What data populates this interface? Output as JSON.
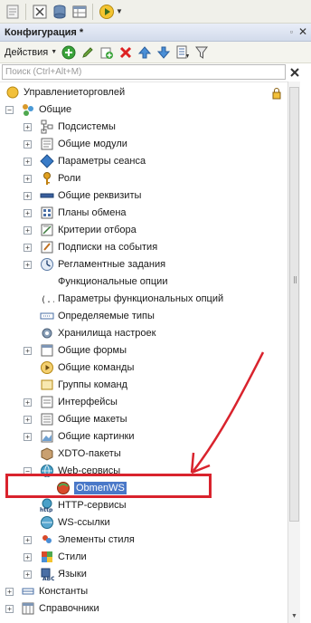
{
  "window": {
    "title": "Конфигурация *"
  },
  "toolbar": {
    "actions_label": "Действия"
  },
  "search": {
    "placeholder": "Поиск (Ctrl+Alt+M)",
    "value": ""
  },
  "tree": {
    "items": [
      {
        "label": "Управлениеторговлей",
        "icon": "config-root-icon",
        "expander": "none",
        "level": 0
      },
      {
        "label": "Общие",
        "icon": "common-folder-icon",
        "expander": "minus",
        "level": 1
      },
      {
        "label": "Подсистемы",
        "icon": "subsystems-icon",
        "expander": "plus",
        "level": 2
      },
      {
        "label": "Общие модули",
        "icon": "common-modules-icon",
        "expander": "plus",
        "level": 2
      },
      {
        "label": "Параметры сеанса",
        "icon": "session-params-icon",
        "expander": "plus",
        "level": 2
      },
      {
        "label": "Роли",
        "icon": "roles-key-icon",
        "expander": "plus",
        "level": 2
      },
      {
        "label": "Общие реквизиты",
        "icon": "common-attributes-icon",
        "expander": "plus",
        "level": 2
      },
      {
        "label": "Планы обмена",
        "icon": "exchange-plans-icon",
        "expander": "plus",
        "level": 2
      },
      {
        "label": "Критерии отбора",
        "icon": "filter-criteria-icon",
        "expander": "plus",
        "level": 2
      },
      {
        "label": "Подписки на события",
        "icon": "event-subscriptions-icon",
        "expander": "plus",
        "level": 2
      },
      {
        "label": "Регламентные задания",
        "icon": "scheduled-jobs-icon",
        "expander": "plus",
        "level": 2
      },
      {
        "label": "Функциональные опции",
        "icon": "functional-options-icon",
        "expander": "none",
        "level": 2
      },
      {
        "label": "Параметры функциональных опций",
        "icon": "functional-option-params-icon",
        "expander": "none",
        "level": 2
      },
      {
        "label": "Определяемые типы",
        "icon": "defined-types-icon",
        "expander": "none",
        "level": 2
      },
      {
        "label": "Хранилища настроек",
        "icon": "settings-storages-icon",
        "expander": "none",
        "level": 2
      },
      {
        "label": "Общие формы",
        "icon": "common-forms-icon",
        "expander": "plus",
        "level": 2
      },
      {
        "label": "Общие команды",
        "icon": "common-commands-icon",
        "expander": "none",
        "level": 2
      },
      {
        "label": "Группы команд",
        "icon": "command-groups-icon",
        "expander": "none",
        "level": 2
      },
      {
        "label": "Интерфейсы",
        "icon": "interfaces-icon",
        "expander": "plus",
        "level": 2
      },
      {
        "label": "Общие макеты",
        "icon": "common-templates-icon",
        "expander": "plus",
        "level": 2
      },
      {
        "label": "Общие картинки",
        "icon": "common-pictures-icon",
        "expander": "plus",
        "level": 2
      },
      {
        "label": "XDTO-пакеты",
        "icon": "xdto-packages-icon",
        "expander": "none",
        "level": 2
      },
      {
        "label": "Web-сервисы",
        "icon": "web-services-globe-icon",
        "expander": "minus",
        "level": 2
      },
      {
        "label": "ObmenWS",
        "icon": "web-service-item-icon",
        "expander": "none",
        "level": 3,
        "selected": true
      },
      {
        "label": "HTTP-сервисы",
        "icon": "http-services-icon",
        "expander": "none",
        "level": 2
      },
      {
        "label": "WS-ссылки",
        "icon": "ws-links-icon",
        "expander": "none",
        "level": 2
      },
      {
        "label": "Элементы стиля",
        "icon": "style-elements-icon",
        "expander": "plus",
        "level": 2
      },
      {
        "label": "Стили",
        "icon": "styles-icon",
        "expander": "plus",
        "level": 2
      },
      {
        "label": "Языки",
        "icon": "languages-icon",
        "expander": "plus",
        "level": 2
      },
      {
        "label": "Константы",
        "icon": "constants-icon",
        "expander": "plus",
        "level": 1
      },
      {
        "label": "Справочники",
        "icon": "catalogs-icon",
        "expander": "plus",
        "level": 1
      }
    ]
  },
  "colors": {
    "selection": "#4a78c8",
    "annotation": "#d9232d"
  }
}
